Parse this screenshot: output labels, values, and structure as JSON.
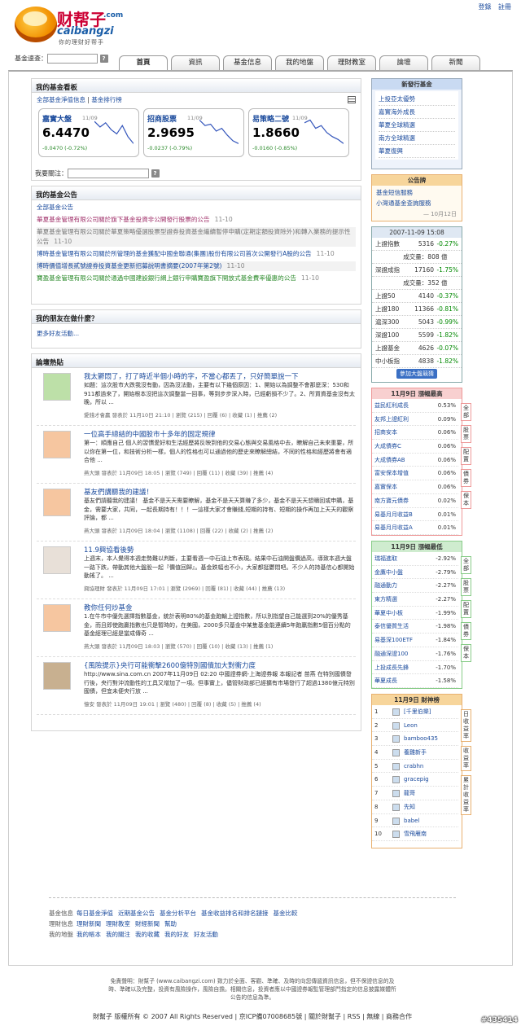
{
  "header": {
    "logo_cn": "财帮子",
    "logo_com": ".com",
    "logo_en": "caibangzi",
    "slogan": "你的理财好帮手",
    "login": "登錄",
    "register": "註冊",
    "search_label": "基金速查：",
    "search_help": "?"
  },
  "tabs": [
    "首頁",
    "資訊",
    "基金信息",
    "我的地盤",
    "理財教室",
    "論壇",
    "新聞"
  ],
  "fund_board": {
    "title": "我的基金看板",
    "link1": "全部基金淨值信息",
    "sep": "|",
    "link2": "基金排行榜",
    "watch_label": "我要關注：",
    "watch_help": "?",
    "funds": [
      {
        "name": "嘉實大盤",
        "date": "11/09",
        "value": "6.4470",
        "change": "-0.0470 (-0.72%)",
        "trend": [
          0.15,
          0.35,
          0.2,
          0.45,
          0.6,
          0.3,
          0.7,
          0.95
        ]
      },
      {
        "name": "招商股票",
        "date": "11/09",
        "value": "2.9695",
        "change": "-0.0237 (-0.79%)",
        "trend": [
          0.1,
          0.3,
          0.25,
          0.5,
          0.4,
          0.65,
          0.85,
          0.95
        ]
      },
      {
        "name": "易策略二號",
        "date": "11/09",
        "value": "1.8660",
        "change": "-0.0160 (-0.85%)",
        "trend": [
          0.2,
          0.1,
          0.4,
          0.3,
          0.55,
          0.7,
          0.8,
          0.95
        ]
      }
    ]
  },
  "announce": {
    "title": "我的基金公告",
    "all": "全部基金公告",
    "items": [
      {
        "text": "華夏基金管理有限公司關於旗下基金投資非公開發行股票的公告",
        "date": "11-10"
      },
      {
        "text": "華夏基金管理有限公司關於華夏策略優選股票型證券投資基金繼續暫停申購(定期定額投資除外)和轉入業務的提示性公告",
        "date": "11-10"
      },
      {
        "text": "博時基金管理有限公司關於所管理的基金獲配中國金聯通(集團)股份有限公司首次公開發行A股的公告",
        "date": "11-10"
      },
      {
        "text": "博時價值增長貳號證券投資基金更新招募說明書摘要(2007年第2號)",
        "date": "11-10"
      },
      {
        "text": "寶盈基金管理有限公司關於通過中國建設銀行網上銀行申購寶盈旗下開放式基金費率優惠的公告",
        "date": "11-10"
      }
    ]
  },
  "friends": {
    "title": "我的朋友在做什麼？",
    "more": "更多好友活動..."
  },
  "forum": {
    "title": "論壇熱貼",
    "posts": [
      {
        "title": "我太鬱悶了，打了時近半個小時的字，不當心都丟了，只好簡單說一下",
        "body": "如題：這次股市大跌我沒有動，因為沒法動，主要有以下幾個原因：1、開始以為調整不會那麼深：530和911都過來了，開始根本沒把這次調整當一回事，等到步步深入時，已經虧損不少了。2、所買資基金沒有太晚，所以 ...",
        "meta": "愛錢才會贏 發表於 11月10日 21:10 | 瀏覽 (215) | 回覆 (6) | 收藏 (1) | 推薦 (2)"
      },
      {
        "title": "一位高手總結的中國股市十多年的固定規律",
        "body": "第一：順應自己 個人的習慣愛好和生活經歷將反映到他的交易心態與交易風格中去，瞭解自己未來重要，所以你在第一位，和技術分析一樣，個人的性格也可以通過他的歷史來瞭解總結，不同的性格和經歷將會有適合他 ...",
        "meta": "燕大頭 發表於 11月09日 18:05 | 瀏覽 (749) | 回覆 (11) | 收藏 (39) | 推薦 (4)"
      },
      {
        "title": "基友們講聽我的建議！",
        "body": "基友們請聽我的建議！ 基金不是天天需要瞭解，基金不是天天算賺了多少，基金不是天天想贖回或申購，基金，需要大家，共同，一起長期持有！！！一這樣大家才會賺錢,短期的持有、短期的操作再加上天天的觀察評論，都 ...",
        "meta": "燕大頭 發表於 11月09日 18:04 | 瀏覽 (1108) | 回覆 (22) | 收藏 (2) | 推薦 (2)"
      },
      {
        "title": "11.9興協看後勢",
        "body": "上週末，本人覺得本週走勢難以判斷，主要看週一中石油上市表現。結果中石油開盤價過高，導致本週大盤一路下跌，帶動其他大盤股一起『價值回歸』。基金跌幅也不小，大家都挺鬱悶吧。不少人的持基信心都開始動搖了。 ...",
        "meta": "興協理財 發表於 11月09日 17:01 | 瀏覽 (2969) | 回覆 (81) | 收藏 (44) | 推薦 (13)"
      },
      {
        "title": "教你任何炒基金",
        "body": "1.在牛市中優先選擇指數基金，統計表明80%的基金跑輸上證指數，所以別指望自己能選到20%的優秀基金，而且即使跑贏指數也只是暫時的，在美國，2000多只基金中某隻基金能連續5年跑贏指數5個百分點的基金經理已經是當成傳奇 ...",
        "meta": "燕大頭 發表於 11月09日 18:03 | 瀏覽 (570) | 回覆 (10) | 收藏 (13) | 推薦 (1)"
      },
      {
        "title": "{風險提示}央行可能衝擊2600億特別國債加大對衝力度",
        "body": "http://www.sina.com.cn 2007年11月09日 02:20 中國證券網-上海證券報 本報記者 苗燕 在特別國債發行後，央行對沖流動性的工具又增加了一項。但事實上，儘管財政部已經擴有市場發行了超過1380億元特別國債，但宜未便央行放 ...",
        "meta": "憶安 發表於 11月09日 19:01 | 瀏覽 (480) | 回覆 (8) | 收藏 (5) | 推薦 (4)"
      }
    ]
  },
  "new_funds": {
    "title": "新發行基金",
    "items": [
      "上投亞太優勢",
      "嘉實海外成長",
      "華夏全球精選",
      "南方全球精選",
      "華夏復興"
    ]
  },
  "notice": {
    "title": "公告牌",
    "items": [
      "基金短信服務",
      "小灣通基金查詢服務"
    ],
    "date": "— 10月12日"
  },
  "market": {
    "time": "2007-11-09 15:08",
    "rows": [
      {
        "name": "上證指數",
        "val": "5316",
        "pct": "-0.27%"
      },
      {
        "name": "",
        "val": "成交量：808 億",
        "pct": ""
      },
      {
        "name": "深證成指",
        "val": "17160",
        "pct": "-1.75%"
      },
      {
        "name": "",
        "val": "成交量：352 億",
        "pct": ""
      },
      {
        "name": "上證50",
        "val": "4140",
        "pct": "-0.37%"
      },
      {
        "name": "上證180",
        "val": "11366",
        "pct": "-0.81%"
      },
      {
        "name": "滬深300",
        "val": "5043",
        "pct": "-0.99%"
      },
      {
        "name": "深證100",
        "val": "5599",
        "pct": "-1.82%"
      },
      {
        "name": "上證基金",
        "val": "4626",
        "pct": "-0.07%"
      },
      {
        "name": "中小板指",
        "val": "4838",
        "pct": "-1.82%"
      }
    ],
    "button": "參加大盤競猜"
  },
  "gainers": {
    "title": "11月9日 漲幅最高",
    "items": [
      [
        "益民紅利成長",
        "0.53%"
      ],
      [
        "友邦上證紅利",
        "0.09%"
      ],
      [
        "招商安本",
        "0.06%"
      ],
      [
        "大成債券C",
        "0.06%"
      ],
      [
        "大成債券AB",
        "0.06%"
      ],
      [
        "富安保本增值",
        "0.06%"
      ],
      [
        "嘉實保本",
        "0.06%"
      ],
      [
        "南方寶元債券",
        "0.02%"
      ],
      [
        "易基月月收益B",
        "0.01%"
      ],
      [
        "易基月月收益A",
        "0.01%"
      ]
    ],
    "tabs": [
      "全部",
      "股票",
      "配置",
      "債券",
      "保本"
    ]
  },
  "losers": {
    "title": "11月9日 漲幅最低",
    "items": [
      [
        "瑞福進取",
        "-2.92%"
      ],
      [
        "金鷹中小盤",
        "-2.79%"
      ],
      [
        "融通動力",
        "-2.27%"
      ],
      [
        "東方精選",
        "-2.27%"
      ],
      [
        "華夏中小板",
        "-1.99%"
      ],
      [
        "泰信優質生活",
        "-1.98%"
      ],
      [
        "易基深100ETF",
        "-1.84%"
      ],
      [
        "融通深證100",
        "-1.76%"
      ],
      [
        "上投成長先鋒",
        "-1.70%"
      ],
      [
        "華夏成長",
        "-1.58%"
      ]
    ],
    "tabs": [
      "全部",
      "股票",
      "配置",
      "債券",
      "保本"
    ]
  },
  "wealth": {
    "title": "11月9日 財神榜",
    "items": [
      "[千里伯樂]",
      "Leon",
      "bamboo435",
      "養雞新手",
      "crabhn",
      "gracepig",
      "龍哥",
      "先知",
      "babel",
      "雪飛雁南"
    ],
    "tabs": [
      "日收益率",
      "收益率",
      "累計收益率"
    ]
  },
  "footer": {
    "rows": [
      {
        "label": "基金信息",
        "links": [
          "每日基金淨值",
          "近期基金公告",
          "基金分析平台",
          "基金收益排名和排名鏈接",
          "基金比較"
        ]
      },
      {
        "label": "理財信息",
        "links": [
          "理財新聞",
          "理財教室",
          "財經新聞",
          "幫助"
        ]
      },
      {
        "label": "我的地盤",
        "links": [
          "我的帳本",
          "我的關注",
          "我的收藏",
          "我的好友",
          "好友活動"
        ]
      }
    ],
    "disclaimer": "免責聲明：財幫子 (www.caibangzi.com) 致力於全面、客觀、準確、及時的向您傳遞資訊信息，但不保證信息的及時、準確以及完整，投資有風險操作，風險自擔。相關信息，投資者應以中國證券報監管理部門指定的信息披露媒體所公告的信息為準。",
    "copyright": "財幫子 版權所有 © 2007 All Rights Reserved | 京ICP備07008685號 | 關於財幫子 | RSS | 無線 | 商務合作",
    "watermark": "#435414"
  }
}
